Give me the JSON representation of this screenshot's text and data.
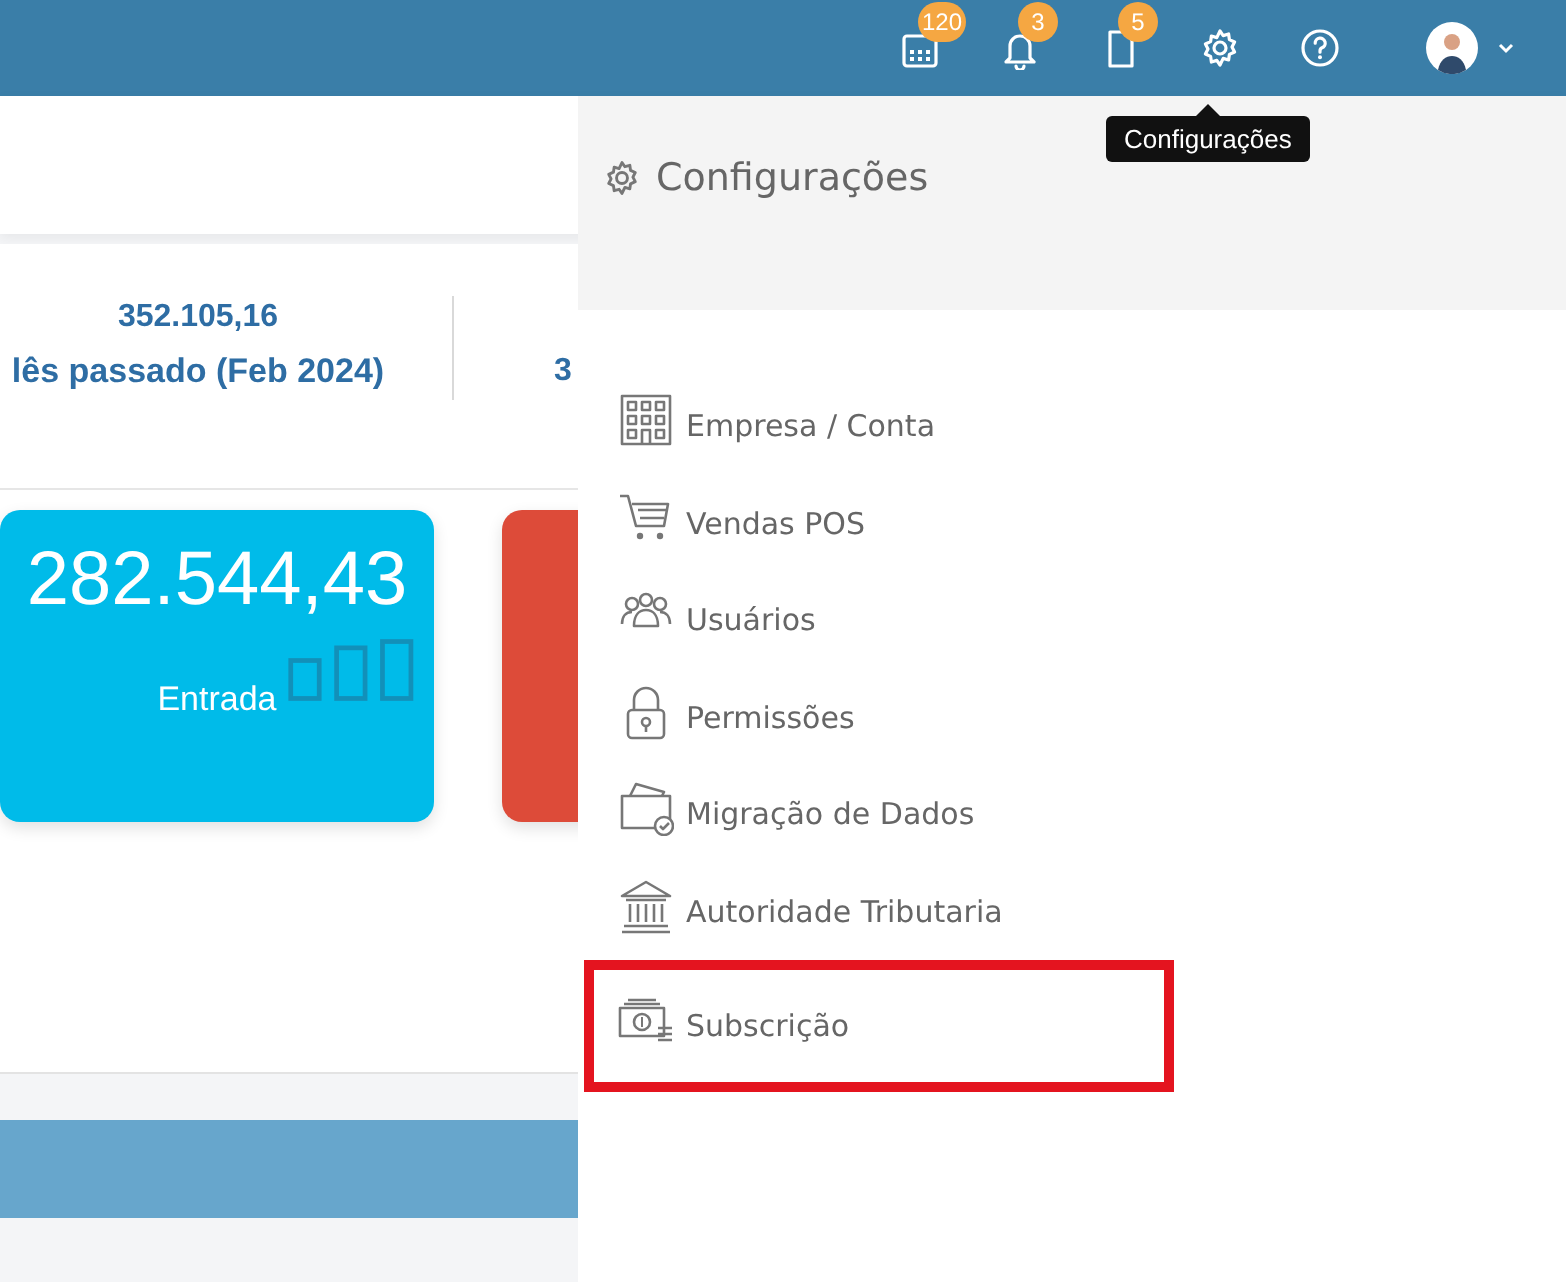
{
  "topbar": {
    "icons": [
      {
        "kind": "calendar",
        "badge": "120"
      },
      {
        "kind": "bell",
        "badge": "3"
      },
      {
        "kind": "document",
        "badge": "5"
      },
      {
        "kind": "settings"
      },
      {
        "kind": "help"
      },
      {
        "kind": "avatar"
      }
    ]
  },
  "tooltip": {
    "text": "Configurações"
  },
  "dashboard": {
    "stats": [
      {
        "value": "352.105,16",
        "label": "lês passado (Feb 2024)"
      },
      {
        "value": "3"
      }
    ],
    "cards": [
      {
        "value": "282.544,43",
        "label": "Entrada",
        "color": "#00bbe9"
      },
      {
        "color": "#dd4b39"
      }
    ]
  },
  "settings_panel": {
    "title": "Configurações",
    "items": [
      {
        "kind": "building",
        "label": "Empresa / Conta",
        "highlighted": false
      },
      {
        "kind": "cart",
        "label": "Vendas POS",
        "highlighted": false
      },
      {
        "kind": "users",
        "label": "Usuários",
        "highlighted": false
      },
      {
        "kind": "lock",
        "label": "Permissões",
        "highlighted": false
      },
      {
        "kind": "migration",
        "label": "Migração de Dados",
        "highlighted": false
      },
      {
        "kind": "bank",
        "label": "Autoridade Tributaria",
        "highlighted": false
      },
      {
        "kind": "money",
        "label": "Subscrição",
        "highlighted": true
      }
    ]
  }
}
